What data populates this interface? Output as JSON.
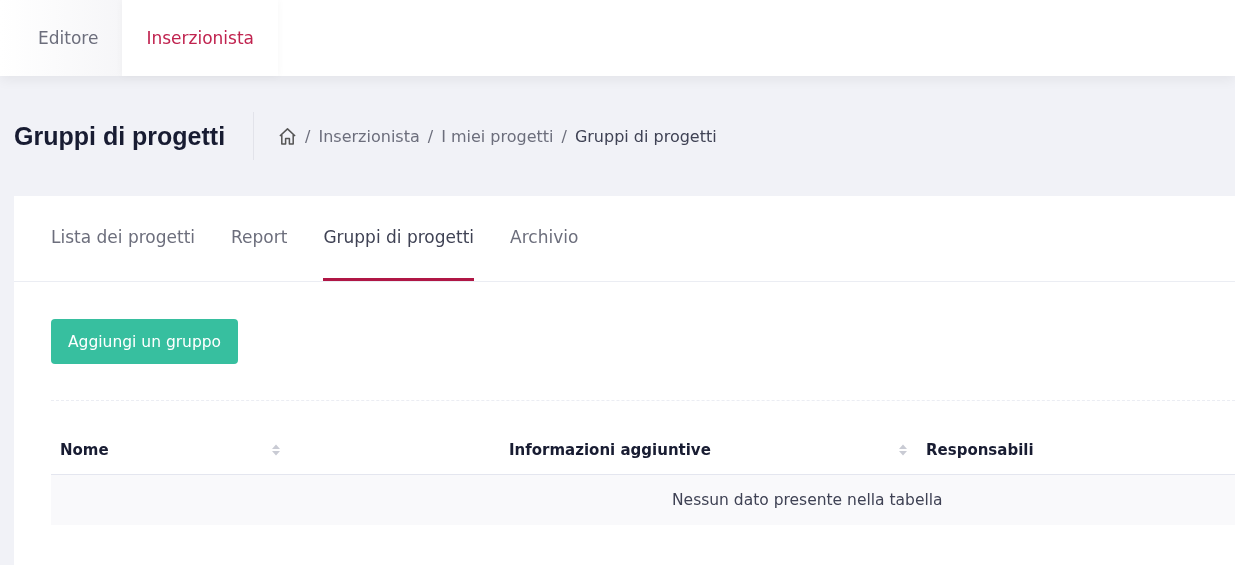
{
  "top_tabs": [
    {
      "label": "Editore",
      "selected": false
    },
    {
      "label": "Inserzionista",
      "selected": true
    }
  ],
  "page_title": "Gruppi di progetti",
  "breadcrumb": [
    {
      "separator": "/",
      "label": "Inserzionista"
    },
    {
      "separator": "/",
      "label": "I miei progetti"
    },
    {
      "separator": "/",
      "label": "Gruppi di progetti"
    }
  ],
  "tabs": [
    {
      "label": "Lista dei progetti",
      "selected": false
    },
    {
      "label": "Report",
      "selected": false
    },
    {
      "label": "Gruppi di progetti",
      "selected": true
    },
    {
      "label": "Archivio",
      "selected": false
    }
  ],
  "add_button": "Aggiungi un gruppo",
  "table": {
    "columns": [
      {
        "label": "Nome",
        "sortable": true
      },
      {
        "label": "Informazioni aggiuntive",
        "sortable": true
      },
      {
        "label": "Responsabili",
        "sortable": false
      }
    ],
    "empty_message": "Nessun dato presente nella tabella"
  }
}
